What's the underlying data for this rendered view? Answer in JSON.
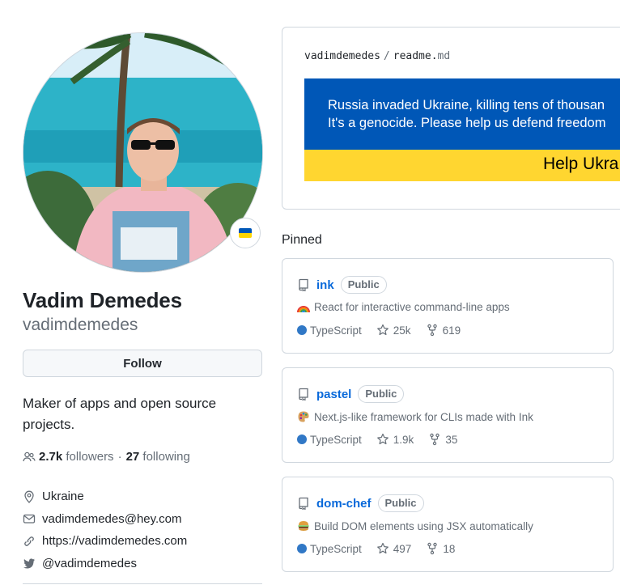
{
  "profile": {
    "full_name": "Vadim Demedes",
    "username": "vadimdemedes",
    "follow_label": "Follow",
    "bio": "Maker of apps and open source projects.",
    "followers_count": "2.7k",
    "followers_label": "followers",
    "separator": "·",
    "following_count": "27",
    "following_label": "following",
    "location": "Ukraine",
    "email": "vadimdemedes@hey.com",
    "website": "https://vadimdemedes.com",
    "twitter": "@vadimdemedes"
  },
  "readme": {
    "owner": "vadimdemedes",
    "separator": "/",
    "file_base": "readme.",
    "file_ext": "md",
    "banner_line1": "Russia invaded Ukraine, killing tens of thousan",
    "banner_line2": "It's a genocide. Please help us defend freedom",
    "banner_cta": "Help Ukra"
  },
  "pinned": {
    "title": "Pinned",
    "repos": [
      {
        "name": "ink",
        "visibility": "Public",
        "description": "React for interactive command-line apps",
        "emoji": "rainbow",
        "language": "TypeScript",
        "stars": "25k",
        "forks": "619"
      },
      {
        "name": "pastel",
        "visibility": "Public",
        "description": "Next.js-like framework for CLIs made with Ink",
        "emoji": "palette",
        "language": "TypeScript",
        "stars": "1.9k",
        "forks": "35"
      },
      {
        "name": "dom-chef",
        "visibility": "Public",
        "description": "Build DOM elements using JSX automatically",
        "emoji": "burger",
        "language": "TypeScript",
        "stars": "497",
        "forks": "18"
      }
    ]
  },
  "colors": {
    "link": "#0969da",
    "muted": "#656d76",
    "border": "#d0d7de",
    "typescript": "#3178c6",
    "ukraine_blue": "#0057b7",
    "ukraine_yellow": "#ffd630"
  }
}
